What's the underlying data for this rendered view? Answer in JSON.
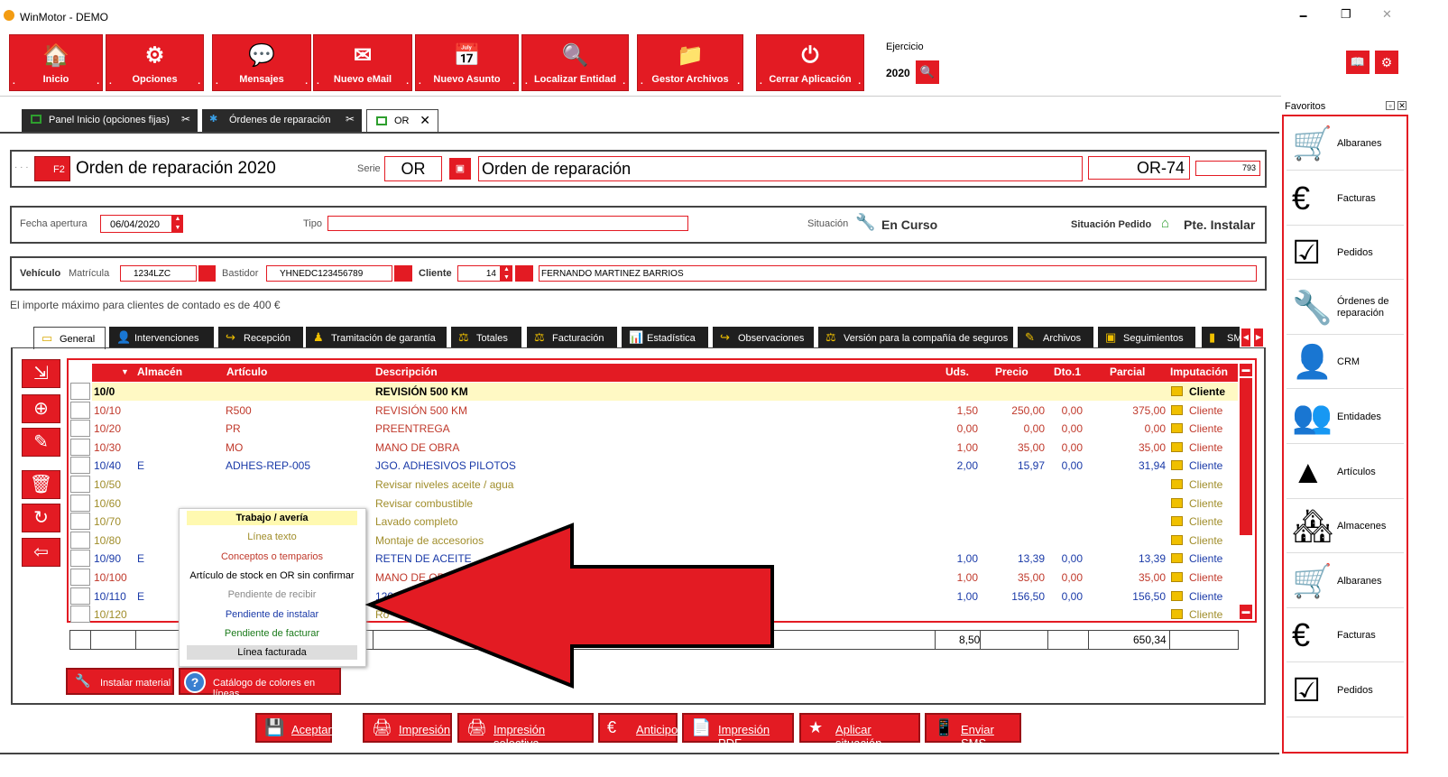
{
  "window": {
    "title": "WinMotor - DEMO",
    "min": "🗕",
    "max": "❐",
    "close": "✕"
  },
  "toolbar": [
    {
      "label": "Inicio",
      "icon": "🏠"
    },
    {
      "label": "Opciones",
      "icon": "⚙"
    },
    {
      "label": "Mensajes",
      "icon": "💬"
    },
    {
      "label": "Nuevo eMail",
      "icon": "✉"
    },
    {
      "label": "Nuevo Asunto",
      "icon": "📅"
    },
    {
      "label": "Localizar Entidad",
      "icon": "🔍"
    },
    {
      "label": "Gestor Archivos",
      "icon": "📁"
    },
    {
      "label": "Cerrar Aplicación",
      "icon": "⏻"
    }
  ],
  "ejercicio": {
    "label": "Ejercicio",
    "value": "2020"
  },
  "tabs": [
    {
      "label": "Panel Inicio (opciones fijas)"
    },
    {
      "label": "Órdenes de reparación"
    },
    {
      "label": "OR"
    }
  ],
  "header": {
    "f2": "F2",
    "title": "Orden de reparación 2020",
    "serie_label": "Serie",
    "serie": "OR",
    "desc": "Orden de reparación",
    "number": "OR-74",
    "id": "793",
    "dots": "· · ·"
  },
  "row1": {
    "fecha_label": "Fecha apertura",
    "fecha": "06/04/2020",
    "tipo_label": "Tipo",
    "situacion_label": "Situación",
    "situacion": "En Curso",
    "sit_pedido_label": "Situación Pedido",
    "sit_pedido": "Pte. Instalar"
  },
  "row2": {
    "vehiculo": "Vehículo",
    "matricula_label": "Matrícula",
    "matricula": "1234LZC",
    "bastidor_label": "Bastidor",
    "bastidor": "YHNEDC123456789",
    "cliente_label": "Cliente",
    "cliente_num": "14",
    "cliente_name": "FERNANDO MARTINEZ BARRIOS"
  },
  "notice": "El importe máximo para clientes de contado es de 400 €",
  "subtabs": [
    "General",
    "Intervenciones",
    "Recepción",
    "Tramitación de garantía",
    "Totales",
    "Facturación",
    "Estadística",
    "Observaciones",
    "Versión para la compañía de seguros",
    "Archivos",
    "Seguimientos",
    "SM"
  ],
  "grid": {
    "headers": {
      "almacen": "Almacén",
      "articulo": "Artículo",
      "descripcion": "Descripción",
      "uds": "Uds.",
      "precio": "Precio",
      "dto": "Dto.1",
      "parcial": "Parcial",
      "imputacion": "Imputación"
    },
    "rows": [
      {
        "linea": "10/0",
        "alm": "",
        "art": "",
        "desc": "REVISIÓN 500 KM",
        "uds": "",
        "precio": "",
        "dto": "",
        "parcial": "",
        "imp": "Cliente",
        "color": "#000000"
      },
      {
        "linea": "10/10",
        "alm": "",
        "art": "R500",
        "desc": "REVISIÓN 500 KM",
        "uds": "1,50",
        "precio": "250,00",
        "dto": "0,00",
        "parcial": "375,00",
        "imp": "Cliente",
        "color": "#c0392b"
      },
      {
        "linea": "10/20",
        "alm": "",
        "art": "PR",
        "desc": "PREENTREGA",
        "uds": "0,00",
        "precio": "0,00",
        "dto": "0,00",
        "parcial": "0,00",
        "imp": "Cliente",
        "color": "#c0392b"
      },
      {
        "linea": "10/30",
        "alm": "",
        "art": "MO",
        "desc": "MANO DE OBRA",
        "uds": "1,00",
        "precio": "35,00",
        "dto": "0,00",
        "parcial": "35,00",
        "imp": "Cliente",
        "color": "#c0392b"
      },
      {
        "linea": "10/40",
        "alm": "E",
        "art": "ADHES-REP-005",
        "desc": "JGO. ADHESIVOS PILOTOS",
        "uds": "2,00",
        "precio": "15,97",
        "dto": "0,00",
        "parcial": "31,94",
        "imp": "Cliente",
        "color": "#1a3aa8"
      },
      {
        "linea": "10/50",
        "alm": "",
        "art": "",
        "desc": "Revisar niveles aceite / agua",
        "uds": "",
        "precio": "",
        "dto": "",
        "parcial": "",
        "imp": "Cliente",
        "color": "#a08d2a"
      },
      {
        "linea": "10/60",
        "alm": "",
        "art": "",
        "desc": "Revisar combustible",
        "uds": "",
        "precio": "",
        "dto": "",
        "parcial": "",
        "imp": "Cliente",
        "color": "#a08d2a"
      },
      {
        "linea": "10/70",
        "alm": "",
        "art": "",
        "desc": "Lavado completo",
        "uds": "",
        "precio": "",
        "dto": "",
        "parcial": "",
        "imp": "Cliente",
        "color": "#a08d2a"
      },
      {
        "linea": "10/80",
        "alm": "",
        "art": "",
        "desc": "Montaje de accesorios",
        "uds": "",
        "precio": "",
        "dto": "",
        "parcial": "",
        "imp": "Cliente",
        "color": "#a08d2a"
      },
      {
        "linea": "10/90",
        "alm": "E",
        "art": "",
        "desc": "RETEN DE ACEITE",
        "uds": "1,00",
        "precio": "13,39",
        "dto": "0,00",
        "parcial": "13,39",
        "imp": "Cliente",
        "color": "#1a3aa8"
      },
      {
        "linea": "10/100",
        "alm": "",
        "art": "",
        "desc": "MANO DE OBRA",
        "uds": "1,00",
        "precio": "35,00",
        "dto": "0,00",
        "parcial": "35,00",
        "imp": "Cliente",
        "color": "#c0392b"
      },
      {
        "linea": "10/110",
        "alm": "E",
        "art": "",
        "desc": "120/7",
        "uds": "1,00",
        "precio": "156,50",
        "dto": "0,00",
        "parcial": "156,50",
        "imp": "Cliente",
        "color": "#1a3aa8"
      },
      {
        "linea": "10/120",
        "alm": "",
        "art": "",
        "desc": "Ro",
        "uds": "",
        "precio": "",
        "dto": "",
        "parcial": "",
        "imp": "Cliente",
        "color": "#a08d2a"
      }
    ],
    "total_uds": "8,50",
    "total_parcial": "650,34"
  },
  "legend": [
    {
      "label": "Trabajo / avería",
      "color": "#000000",
      "bg": "#fff9b0",
      "bold": true
    },
    {
      "label": "Línea texto",
      "color": "#a08d2a",
      "bg": "",
      "bold": false
    },
    {
      "label": "Conceptos o temparios",
      "color": "#c0392b",
      "bg": "",
      "bold": false
    },
    {
      "label": "Artículo de stock en OR sin confirmar",
      "color": "#000000",
      "bg": "",
      "bold": false
    },
    {
      "label": "Pendiente de recibir",
      "color": "#888888",
      "bg": "",
      "bold": false
    },
    {
      "label": "Pendiente de instalar",
      "color": "#1a3aa8",
      "bg": "",
      "bold": false
    },
    {
      "label": "Pendiente de facturar",
      "color": "#1a7a1a",
      "bg": "",
      "bold": false
    },
    {
      "label": "Línea facturada",
      "color": "#000000",
      "bg": "#dddddd",
      "bold": false
    }
  ],
  "left_buttons": {
    "instalar": "Instalar material",
    "catalogo": "Catálogo de colores en líneas"
  },
  "bottom": [
    {
      "label": "Aceptar",
      "icon": "💾"
    },
    {
      "label": "Impresión",
      "icon": "🖨"
    },
    {
      "label": "Impresión selectiva",
      "icon": "🖨"
    },
    {
      "label": "Anticipo",
      "icon": "€"
    },
    {
      "label": "Impresión PDF",
      "icon": "📄"
    },
    {
      "label": "Aplicar situación",
      "icon": "★"
    },
    {
      "label": "Enviar SMS",
      "icon": "📱"
    }
  ],
  "favoritos": {
    "title": "Favoritos",
    "items": [
      {
        "label": "Albaranes",
        "icon": "🛒"
      },
      {
        "label": "Facturas",
        "icon": "€"
      },
      {
        "label": "Pedidos",
        "icon": "☑"
      },
      {
        "label": "Órdenes de reparación",
        "icon": "🔧"
      },
      {
        "label": "CRM",
        "icon": "👤"
      },
      {
        "label": "Entidades",
        "icon": "👥"
      },
      {
        "label": "Artículos",
        "icon": "▲"
      },
      {
        "label": "Almacenes",
        "icon": "🏘"
      },
      {
        "label": "Albaranes",
        "icon": "🛒"
      },
      {
        "label": "Facturas",
        "icon": "€"
      },
      {
        "label": "Pedidos",
        "icon": "☑"
      }
    ]
  },
  "colors": {
    "accent": "#e31b23",
    "dark": "#1f1f1f",
    "yellow_row": "#fff9c4"
  }
}
